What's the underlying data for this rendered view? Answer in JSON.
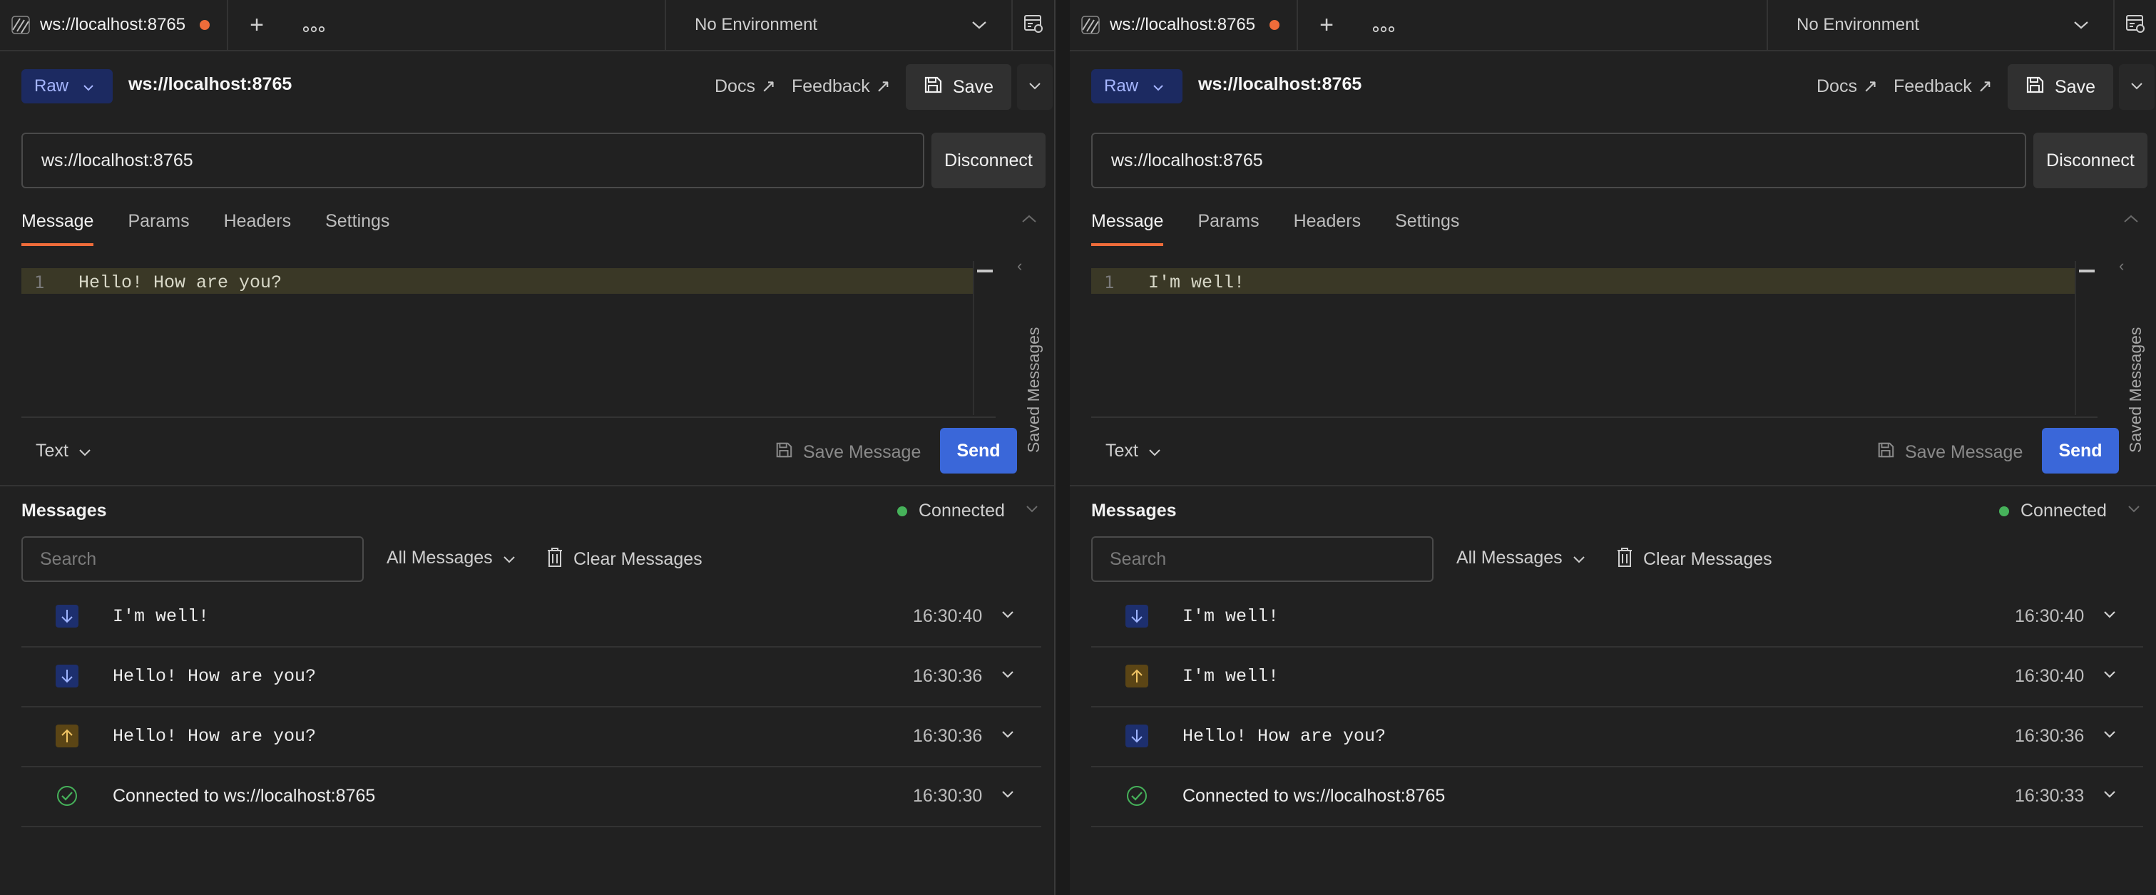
{
  "panes": [
    {
      "tab": {
        "title": "ws://localhost:8765"
      },
      "environment": "No Environment",
      "request": {
        "mode": "Raw",
        "title": "ws://localhost:8765",
        "docs": "Docs",
        "feedback": "Feedback",
        "save": "Save",
        "url": "ws://localhost:8765",
        "disconnect": "Disconnect"
      },
      "subtabs": [
        "Message",
        "Params",
        "Headers",
        "Settings"
      ],
      "editor": {
        "line_number": "1",
        "content": "Hello! How are you?"
      },
      "saved_messages_label": "Saved Messages",
      "format": "Text",
      "save_message": "Save Message",
      "send": "Send",
      "messages": {
        "title": "Messages",
        "status": "Connected",
        "search_placeholder": "Search",
        "filter": "All Messages",
        "clear": "Clear Messages",
        "items": [
          {
            "direction": "incoming",
            "text": "I'm well!",
            "time": "16:30:40"
          },
          {
            "direction": "incoming",
            "text": "Hello! How are you?",
            "time": "16:30:36"
          },
          {
            "direction": "outgoing",
            "text": "Hello! How are you?",
            "time": "16:30:36"
          },
          {
            "direction": "connected",
            "text": "Connected to ws://localhost:8765",
            "time": "16:30:30"
          }
        ]
      }
    },
    {
      "tab": {
        "title": "ws://localhost:8765"
      },
      "environment": "No Environment",
      "request": {
        "mode": "Raw",
        "title": "ws://localhost:8765",
        "docs": "Docs",
        "feedback": "Feedback",
        "save": "Save",
        "url": "ws://localhost:8765",
        "disconnect": "Disconnect"
      },
      "subtabs": [
        "Message",
        "Params",
        "Headers",
        "Settings"
      ],
      "editor": {
        "line_number": "1",
        "content": "I'm well!"
      },
      "saved_messages_label": "Saved Messages",
      "format": "Text",
      "save_message": "Save Message",
      "send": "Send",
      "messages": {
        "title": "Messages",
        "status": "Connected",
        "search_placeholder": "Search",
        "filter": "All Messages",
        "clear": "Clear Messages",
        "items": [
          {
            "direction": "incoming",
            "text": "I'm well!",
            "time": "16:30:40"
          },
          {
            "direction": "outgoing",
            "text": "I'm well!",
            "time": "16:30:40"
          },
          {
            "direction": "incoming",
            "text": "Hello! How are you?",
            "time": "16:30:36"
          },
          {
            "direction": "connected",
            "text": "Connected to ws://localhost:8765",
            "time": "16:30:33"
          }
        ]
      }
    }
  ],
  "colors": {
    "accent_orange": "#ef6c3a",
    "send_blue": "#3a67d9",
    "connected_green": "#46b25a",
    "incoming_bg": "#1d2f6e",
    "outgoing_bg": "#5b4515"
  },
  "icons": {
    "tab": "websocket-icon",
    "new_tab": "plus-icon",
    "more": "more-icon",
    "env": "chevron-down-icon",
    "env_settings": "environment-settings-icon",
    "save": "floppy-disk-icon",
    "incoming": "arrow-down-icon",
    "outgoing": "arrow-up-icon",
    "connected": "check-circle-icon",
    "clear": "trash-icon"
  }
}
